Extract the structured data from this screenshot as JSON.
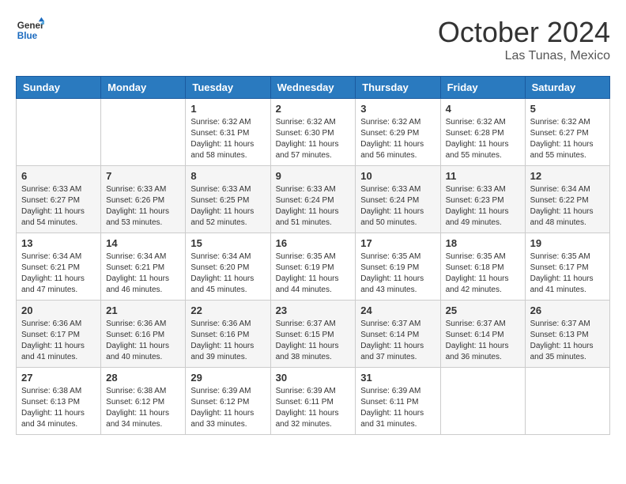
{
  "header": {
    "logo_line1": "General",
    "logo_line2": "Blue",
    "month": "October 2024",
    "location": "Las Tunas, Mexico"
  },
  "days_of_week": [
    "Sunday",
    "Monday",
    "Tuesday",
    "Wednesday",
    "Thursday",
    "Friday",
    "Saturday"
  ],
  "weeks": [
    [
      null,
      null,
      {
        "day": "1",
        "sunrise": "6:32 AM",
        "sunset": "6:31 PM",
        "daylight": "11 hours and 58 minutes."
      },
      {
        "day": "2",
        "sunrise": "6:32 AM",
        "sunset": "6:30 PM",
        "daylight": "11 hours and 57 minutes."
      },
      {
        "day": "3",
        "sunrise": "6:32 AM",
        "sunset": "6:29 PM",
        "daylight": "11 hours and 56 minutes."
      },
      {
        "day": "4",
        "sunrise": "6:32 AM",
        "sunset": "6:28 PM",
        "daylight": "11 hours and 55 minutes."
      },
      {
        "day": "5",
        "sunrise": "6:32 AM",
        "sunset": "6:27 PM",
        "daylight": "11 hours and 55 minutes."
      }
    ],
    [
      {
        "day": "6",
        "sunrise": "6:33 AM",
        "sunset": "6:27 PM",
        "daylight": "11 hours and 54 minutes."
      },
      {
        "day": "7",
        "sunrise": "6:33 AM",
        "sunset": "6:26 PM",
        "daylight": "11 hours and 53 minutes."
      },
      {
        "day": "8",
        "sunrise": "6:33 AM",
        "sunset": "6:25 PM",
        "daylight": "11 hours and 52 minutes."
      },
      {
        "day": "9",
        "sunrise": "6:33 AM",
        "sunset": "6:24 PM",
        "daylight": "11 hours and 51 minutes."
      },
      {
        "day": "10",
        "sunrise": "6:33 AM",
        "sunset": "6:24 PM",
        "daylight": "11 hours and 50 minutes."
      },
      {
        "day": "11",
        "sunrise": "6:33 AM",
        "sunset": "6:23 PM",
        "daylight": "11 hours and 49 minutes."
      },
      {
        "day": "12",
        "sunrise": "6:34 AM",
        "sunset": "6:22 PM",
        "daylight": "11 hours and 48 minutes."
      }
    ],
    [
      {
        "day": "13",
        "sunrise": "6:34 AM",
        "sunset": "6:21 PM",
        "daylight": "11 hours and 47 minutes."
      },
      {
        "day": "14",
        "sunrise": "6:34 AM",
        "sunset": "6:21 PM",
        "daylight": "11 hours and 46 minutes."
      },
      {
        "day": "15",
        "sunrise": "6:34 AM",
        "sunset": "6:20 PM",
        "daylight": "11 hours and 45 minutes."
      },
      {
        "day": "16",
        "sunrise": "6:35 AM",
        "sunset": "6:19 PM",
        "daylight": "11 hours and 44 minutes."
      },
      {
        "day": "17",
        "sunrise": "6:35 AM",
        "sunset": "6:19 PM",
        "daylight": "11 hours and 43 minutes."
      },
      {
        "day": "18",
        "sunrise": "6:35 AM",
        "sunset": "6:18 PM",
        "daylight": "11 hours and 42 minutes."
      },
      {
        "day": "19",
        "sunrise": "6:35 AM",
        "sunset": "6:17 PM",
        "daylight": "11 hours and 41 minutes."
      }
    ],
    [
      {
        "day": "20",
        "sunrise": "6:36 AM",
        "sunset": "6:17 PM",
        "daylight": "11 hours and 41 minutes."
      },
      {
        "day": "21",
        "sunrise": "6:36 AM",
        "sunset": "6:16 PM",
        "daylight": "11 hours and 40 minutes."
      },
      {
        "day": "22",
        "sunrise": "6:36 AM",
        "sunset": "6:16 PM",
        "daylight": "11 hours and 39 minutes."
      },
      {
        "day": "23",
        "sunrise": "6:37 AM",
        "sunset": "6:15 PM",
        "daylight": "11 hours and 38 minutes."
      },
      {
        "day": "24",
        "sunrise": "6:37 AM",
        "sunset": "6:14 PM",
        "daylight": "11 hours and 37 minutes."
      },
      {
        "day": "25",
        "sunrise": "6:37 AM",
        "sunset": "6:14 PM",
        "daylight": "11 hours and 36 minutes."
      },
      {
        "day": "26",
        "sunrise": "6:37 AM",
        "sunset": "6:13 PM",
        "daylight": "11 hours and 35 minutes."
      }
    ],
    [
      {
        "day": "27",
        "sunrise": "6:38 AM",
        "sunset": "6:13 PM",
        "daylight": "11 hours and 34 minutes."
      },
      {
        "day": "28",
        "sunrise": "6:38 AM",
        "sunset": "6:12 PM",
        "daylight": "11 hours and 34 minutes."
      },
      {
        "day": "29",
        "sunrise": "6:39 AM",
        "sunset": "6:12 PM",
        "daylight": "11 hours and 33 minutes."
      },
      {
        "day": "30",
        "sunrise": "6:39 AM",
        "sunset": "6:11 PM",
        "daylight": "11 hours and 32 minutes."
      },
      {
        "day": "31",
        "sunrise": "6:39 AM",
        "sunset": "6:11 PM",
        "daylight": "11 hours and 31 minutes."
      },
      null,
      null
    ]
  ],
  "labels": {
    "sunrise_prefix": "Sunrise: ",
    "sunset_prefix": "Sunset: ",
    "daylight_prefix": "Daylight: "
  }
}
